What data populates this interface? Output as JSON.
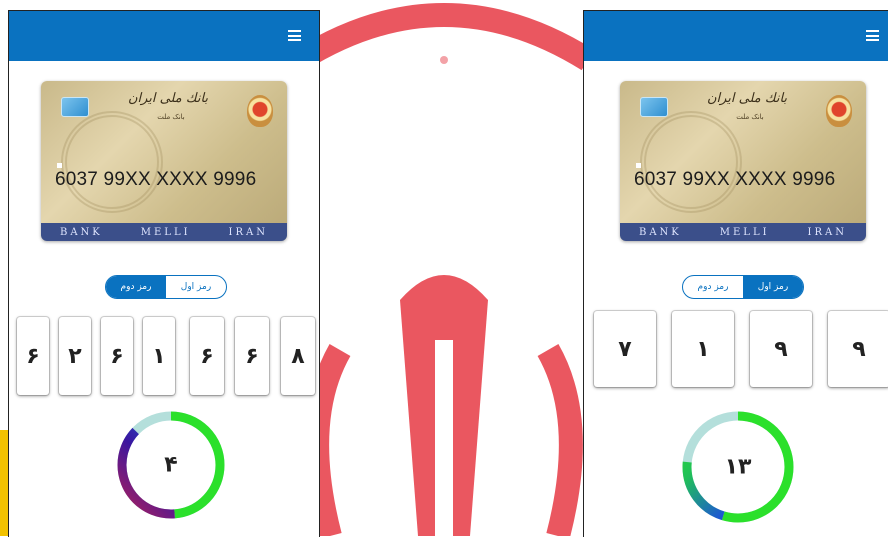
{
  "colors": {
    "appbar": "#0a72c0",
    "emblem": "#e8454f"
  },
  "screens": [
    {
      "menu_icon": "hamburger-menu-icon",
      "card": {
        "bank_name": "بانك ملی ایران",
        "bank_sub": "بانک ملت",
        "number": "6037 99XX XXXX 9996",
        "strip": [
          "BANK",
          "MELLI",
          "IRAN"
        ]
      },
      "tabs": [
        {
          "label": "رمز اول",
          "active": false
        },
        {
          "label": "رمز دوم",
          "active": true
        }
      ],
      "digits": [
        "۶",
        "۲",
        "۶",
        "۱",
        "۶",
        "۶",
        "۸"
      ],
      "timer": {
        "value": "۴",
        "remaining_fraction": 0.87
      }
    },
    {
      "menu_icon": "hamburger-menu-icon",
      "card": {
        "bank_name": "بانك ملی ایران",
        "bank_sub": "بانک ملت",
        "number": "6037 99XX XXXX 9996",
        "strip": [
          "BANK",
          "MELLI",
          "IRAN"
        ]
      },
      "tabs": [
        {
          "label": "رمز اول",
          "active": true
        },
        {
          "label": "رمز دوم",
          "active": false
        }
      ],
      "digits": [
        "۷",
        "۱",
        "۹",
        "۹"
      ],
      "timer": {
        "value": "۱۳",
        "remaining_fraction": 0.87
      }
    }
  ]
}
